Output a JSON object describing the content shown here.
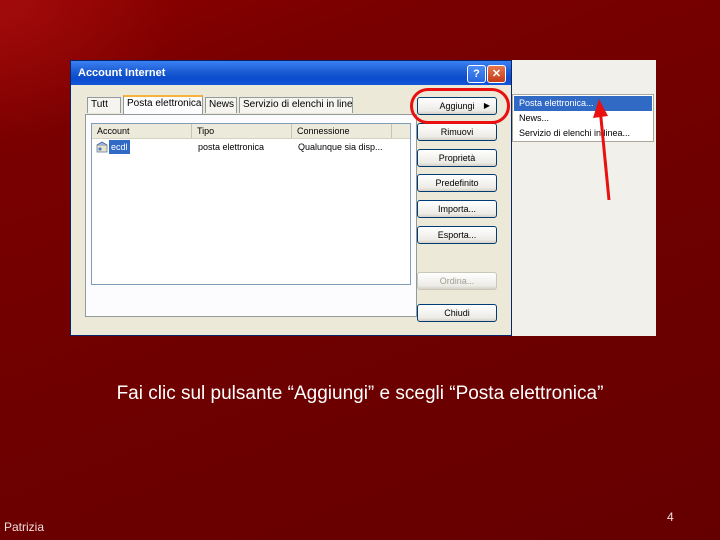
{
  "dialog": {
    "title": "Account Internet",
    "help_glyph": "?",
    "close_glyph": "✕",
    "tabs": [
      "Tutt",
      "Posta elettronica",
      "News",
      "Servizio di elenchi in linea"
    ],
    "active_tab": "Posta elettronica",
    "columns": [
      "Account",
      "Tipo",
      "Connessione"
    ],
    "rows": [
      {
        "account": "ecdl",
        "tipo": "posta elettronica",
        "connessione": "Qualunque sia disp..."
      }
    ],
    "buttons": {
      "aggiungi": "Aggiungi",
      "rimuovi": "Rimuovi",
      "proprieta": "Proprietà",
      "predefinito": "Predefinito",
      "importa": "Importa...",
      "esporta": "Esporta...",
      "ordina": "Ordina...",
      "chiudi": "Chiudi"
    },
    "submenu_arrow": "▶"
  },
  "context_menu": {
    "items": [
      "Posta elettronica...",
      "News...",
      "Servizio di elenchi in linea..."
    ],
    "highlighted": "Posta elettronica..."
  },
  "slide": {
    "caption": "Fai clic sul pulsante “Aggiungi” e scegli “Posta elettronica”",
    "author": "Patrizia",
    "page_number": "4"
  },
  "colors": {
    "background": "#7a0000",
    "annotation_red": "#e81010",
    "selection_blue": "#316ac5",
    "titlebar_blue": "#0a4ccc"
  }
}
